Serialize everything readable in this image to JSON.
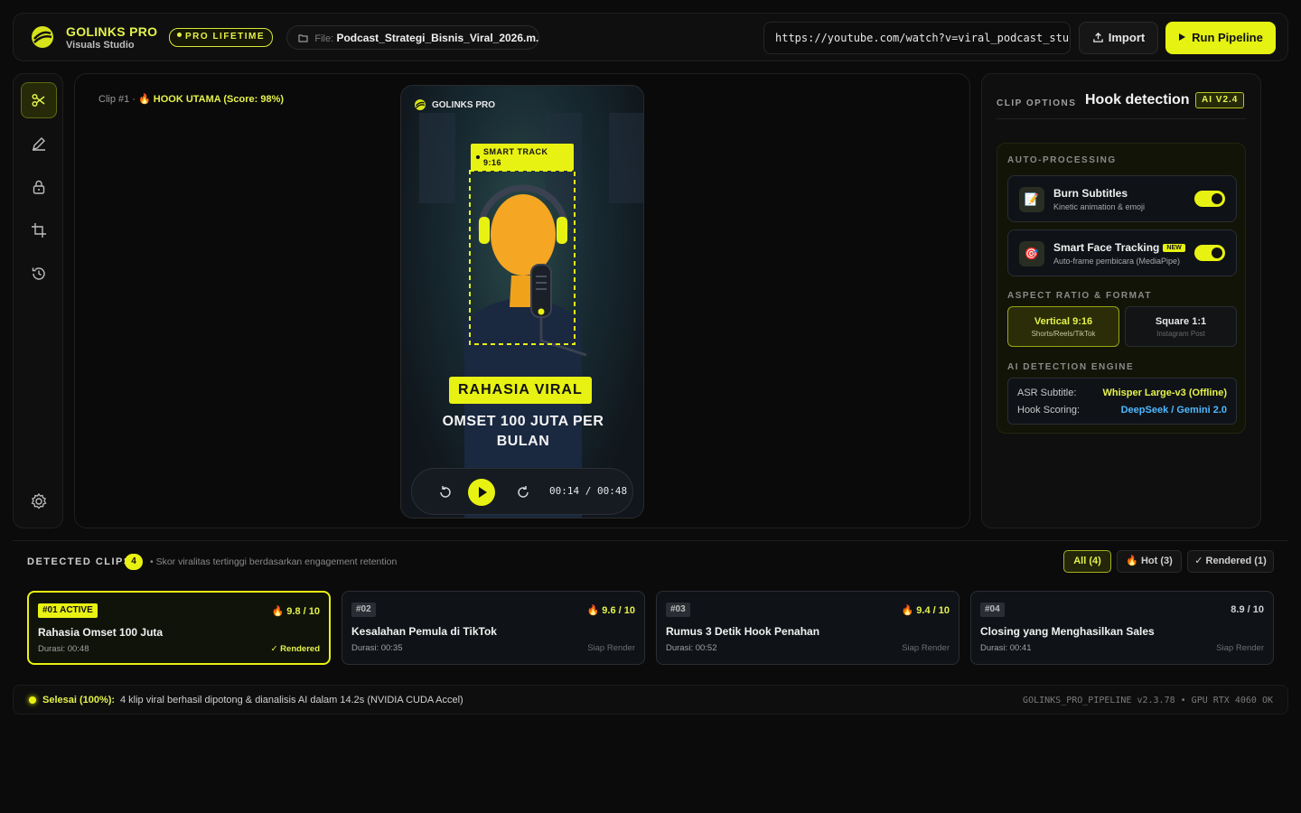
{
  "brand": {
    "title": "GOLINKS PRO",
    "subtitle": "Visuals Studio",
    "badge": "PRO LIFETIME"
  },
  "file": {
    "label": "File:",
    "name": "Podcast_Strategi_Bisnis_Viral_2026.m..."
  },
  "url_input": {
    "value": "https://youtube.com/watch?v=viral_podcast_stu"
  },
  "buttons": {
    "import": "Import",
    "run": "Run Pipeline"
  },
  "tools": [
    "scissors-icon",
    "pen-icon",
    "lock-icon",
    "crop-icon",
    "history-icon",
    "settings-icon"
  ],
  "preview": {
    "clip_prefix": "Clip #1 ·",
    "hook": "🔥 HOOK UTAMA (Score: 98%)",
    "phone_brand": "GOLINKS PRO",
    "track_line1": "SMART TRACK",
    "track_line2": "9:16",
    "caption_highlight": "RAHASIA VIRAL",
    "caption_main": "OMSET 100 JUTA PER BULAN",
    "time": "00:14 / 00:48"
  },
  "options": {
    "header_label": "CLIP OPTIONS",
    "header_title": "Hook detection",
    "ai_badge": "AI V2.4",
    "section_auto": "AUTO-PROCESSING",
    "burn": {
      "title": "Burn Subtitles",
      "desc": "Kinetic animation & emoji",
      "enabled": true
    },
    "face": {
      "title": "Smart Face Tracking",
      "badge": "NEW",
      "desc": "Auto-frame pembicara (MediaPipe)",
      "enabled": true
    },
    "section_ratio": "ASPECT RATIO & FORMAT",
    "ratio_vertical": {
      "title": "Vertical 9:16",
      "desc": "Shorts/Reels/TikTok"
    },
    "ratio_square": {
      "title": "Square 1:1",
      "desc": "Instagram Post"
    },
    "section_engine": "AI DETECTION ENGINE",
    "asr_label": "ASR Subtitle:",
    "asr_value": "Whisper Large-v3 (Offline)",
    "hook_label": "Hook Scoring:",
    "hook_value": "DeepSeek / Gemini 2.0"
  },
  "clips": {
    "heading": "DETECTED CLIPS",
    "count": "4",
    "note": "• Skor viralitas tertinggi berdasarkan engagement retention",
    "filters": {
      "all": "All (4)",
      "hot": "🔥 Hot (3)",
      "rendered": "✓ Rendered (1)"
    },
    "items": [
      {
        "num": "#01 ACTIVE",
        "score": "🔥 9.8 / 10",
        "title": "Rahasia Omset 100 Juta",
        "duration": "Durasi: 00:48",
        "status": "✓ Rendered"
      },
      {
        "num": "#02",
        "score": "🔥 9.6 / 10",
        "title": "Kesalahan Pemula di TikTok",
        "duration": "Durasi: 00:35",
        "status": "Siap Render"
      },
      {
        "num": "#03",
        "score": "🔥 9.4 / 10",
        "title": "Rumus 3 Detik Hook Penahan",
        "duration": "Durasi: 00:52",
        "status": "Siap Render"
      },
      {
        "num": "#04",
        "score": "8.9 / 10",
        "title": "Closing yang Menghasilkan Sales",
        "duration": "Durasi: 00:41",
        "status": "Siap Render"
      }
    ]
  },
  "status": {
    "state": "Selesai (100%):",
    "message": "4 klip viral berhasil dipotong & dianalisis AI dalam 14.2s (NVIDIA CUDA Accel)",
    "version": "GOLINKS_PRO_PIPELINE v2.3.78 • GPU RTX 4060 OK"
  },
  "colors": {
    "accent": "#e8f212",
    "background": "#0b0b0b",
    "link": "#4fb8ff"
  }
}
